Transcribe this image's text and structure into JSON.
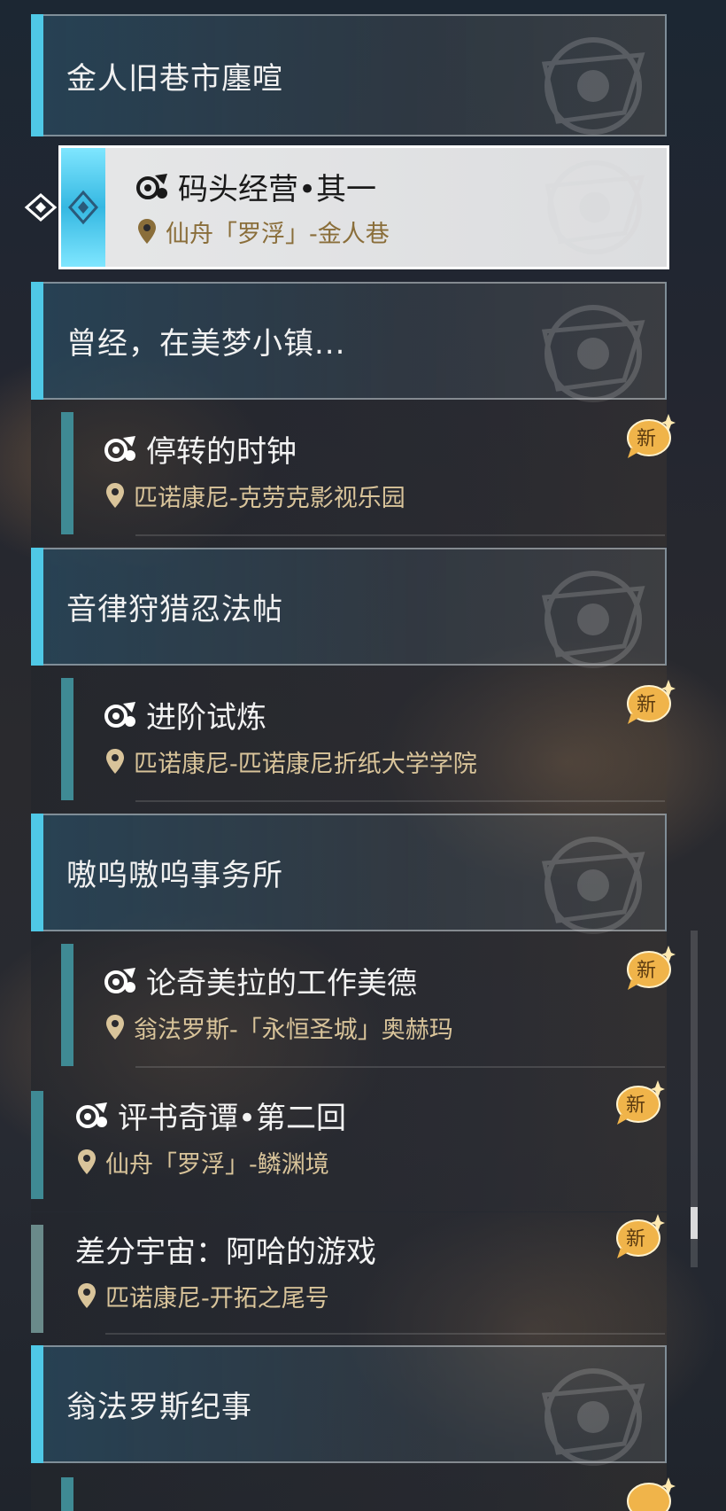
{
  "groups": [
    {
      "title": "金人旧巷市廛喧"
    },
    {
      "title": "曾经，在美梦小镇..."
    },
    {
      "title": "音律狩猎忍法帖"
    },
    {
      "title": "嗷呜嗷呜事务所"
    },
    {
      "title": "翁法罗斯纪事"
    }
  ],
  "selected_quest": {
    "name": "码头经营•其一",
    "location": "仙舟「罗浮」-金人巷"
  },
  "quests": [
    {
      "name": "停转的时钟",
      "location": "匹诺康尼-克劳克影视乐园",
      "badge": "新"
    },
    {
      "name": "进阶试炼",
      "location": "匹诺康尼-匹诺康尼折纸大学学院",
      "badge": "新"
    },
    {
      "name": "论奇美拉的工作美德",
      "location": "翁法罗斯-「永恒圣城」奥赫玛",
      "badge": "新"
    },
    {
      "name": "评书奇谭•第二回",
      "location": "仙舟「罗浮」-鳞渊境",
      "badge": "新"
    },
    {
      "name": "差分宇宙：阿哈的游戏",
      "location": "匹诺康尼-开拓之尾号",
      "badge": "新"
    }
  ],
  "colors": {
    "accent": "#4fc8e6",
    "location_text": "#d9c49a",
    "badge": "#f0b44a"
  },
  "icons": {
    "quest": "quest-type-icon",
    "location": "location-pin-icon",
    "badge": "new-badge-icon",
    "pointer": "selection-pointer-icon"
  }
}
